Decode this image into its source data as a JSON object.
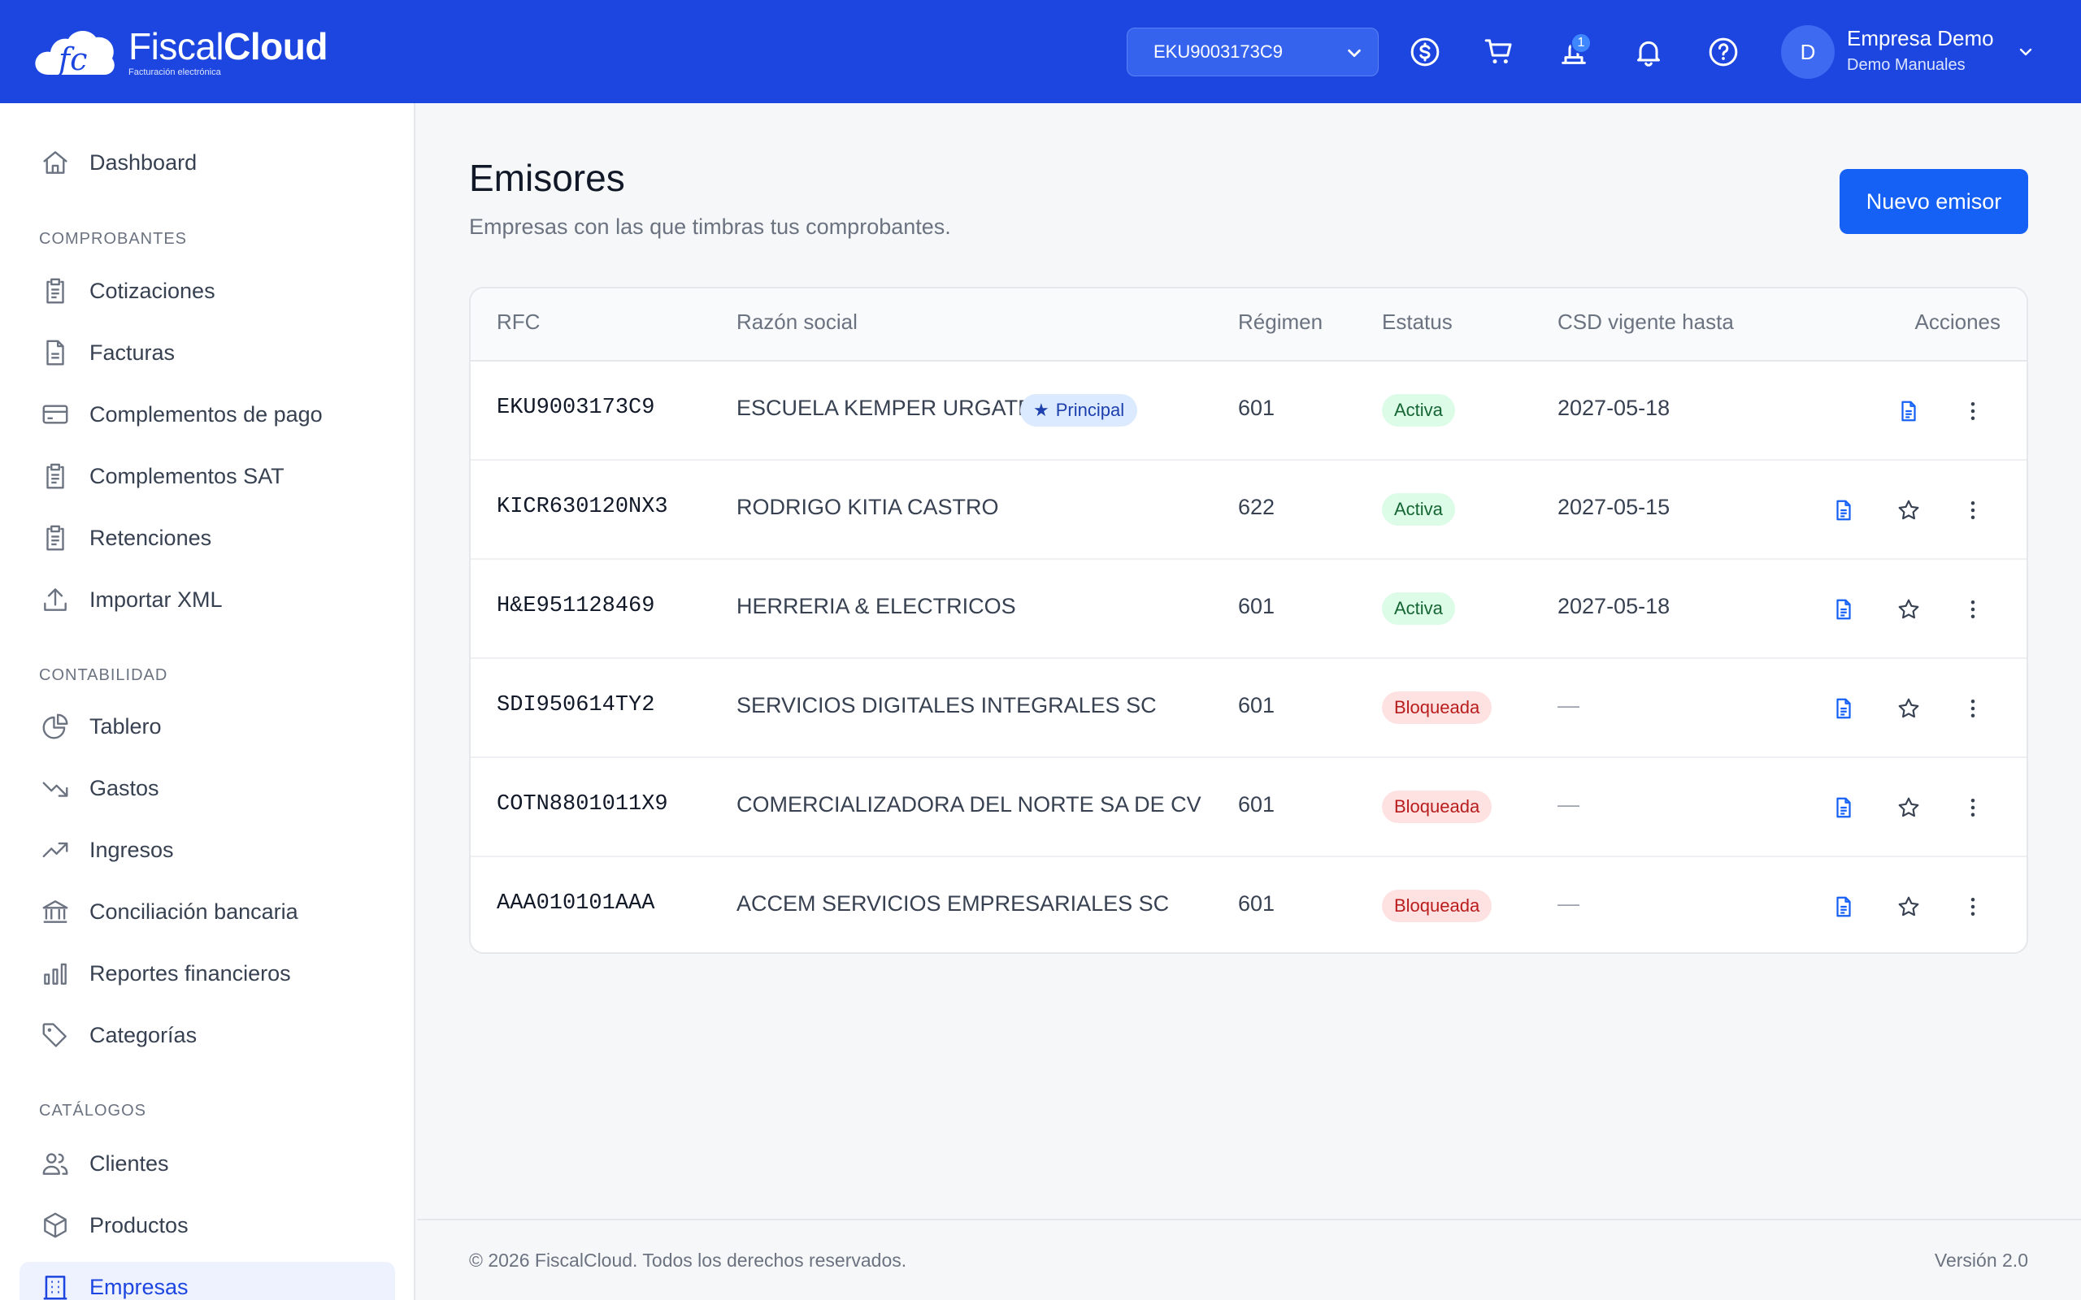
{
  "header": {
    "brand_light": "Fiscal",
    "brand_bold": "Cloud",
    "brand_tagline": "Facturación electrónica",
    "rfc_selected": "EKU9003173C9",
    "notification_count": "1",
    "avatar_initial": "D",
    "user_name": "Empresa Demo",
    "user_subtitle": "Demo Manuales",
    "accent_color": "#1d46e0",
    "icons": [
      "dollar-icon",
      "cart-icon",
      "stamp-icon",
      "bell-icon",
      "help-icon"
    ]
  },
  "sidebar": {
    "dashboard": "Dashboard",
    "section_comprobantes": "COMPROBANTES",
    "comprobantes": [
      {
        "label": "Cotizaciones",
        "icon": "clipboard-icon"
      },
      {
        "label": "Facturas",
        "icon": "document-icon"
      },
      {
        "label": "Complementos de pago",
        "icon": "credit-card-icon"
      },
      {
        "label": "Complementos SAT",
        "icon": "clipboard-icon"
      },
      {
        "label": "Retenciones",
        "icon": "clipboard-icon"
      },
      {
        "label": "Importar XML",
        "icon": "upload-icon"
      }
    ],
    "section_contabilidad": "CONTABILIDAD",
    "contabilidad": [
      {
        "label": "Tablero",
        "icon": "pie-chart-icon"
      },
      {
        "label": "Gastos",
        "icon": "trending-down-icon"
      },
      {
        "label": "Ingresos",
        "icon": "trending-up-icon"
      },
      {
        "label": "Conciliación bancaria",
        "icon": "bank-icon"
      },
      {
        "label": "Reportes financieros",
        "icon": "bar-chart-icon"
      },
      {
        "label": "Categorías",
        "icon": "tag-icon"
      }
    ],
    "section_catalogos": "CATÁLOGOS",
    "catalogos": [
      {
        "label": "Clientes",
        "icon": "users-icon"
      },
      {
        "label": "Productos",
        "icon": "box-icon"
      },
      {
        "label": "Empresas",
        "icon": "building-icon",
        "active": true
      }
    ]
  },
  "main": {
    "title": "Emisores",
    "subtitle": "Empresas con las que timbras tus comprobantes.",
    "new_button": "Nuevo emisor",
    "columns": [
      "RFC",
      "Razón social",
      "Régimen",
      "Estatus",
      "CSD vigente hasta",
      "Acciones"
    ],
    "principal_label": "Principal",
    "rows": [
      {
        "rfc": "EKU9003173C9",
        "razon": "ESCUELA KEMPER URGATE",
        "principal": true,
        "regimen": "601",
        "estatus": "Activa",
        "status_type": "ok",
        "csd": "2027-05-18"
      },
      {
        "rfc": "KICR630120NX3",
        "razon": "RODRIGO KITIA CASTRO",
        "principal": false,
        "regimen": "622",
        "estatus": "Activa",
        "status_type": "ok",
        "csd": "2027-05-15"
      },
      {
        "rfc": "H&E951128469",
        "razon": "HERRERIA & ELECTRICOS",
        "principal": false,
        "regimen": "601",
        "estatus": "Activa",
        "status_type": "ok",
        "csd": "2027-05-18"
      },
      {
        "rfc": "SDI950614TY2",
        "razon": "SERVICIOS DIGITALES INTEGRALES SC",
        "principal": false,
        "regimen": "601",
        "estatus": "Bloqueada",
        "status_type": "bad",
        "csd": "—"
      },
      {
        "rfc": "COTN8801011X9",
        "razon": "COMERCIALIZADORA DEL NORTE SA DE CV",
        "principal": false,
        "regimen": "601",
        "estatus": "Bloqueada",
        "status_type": "bad",
        "csd": "—"
      },
      {
        "rfc": "AAA010101AAA",
        "razon": "ACCEM SERVICIOS EMPRESARIALES SC",
        "principal": false,
        "regimen": "601",
        "estatus": "Bloqueada",
        "status_type": "bad",
        "csd": "—"
      }
    ]
  },
  "footer": {
    "copyright": "© 2026 FiscalCloud. Todos los derechos reservados.",
    "version": "Versión 2.0"
  }
}
